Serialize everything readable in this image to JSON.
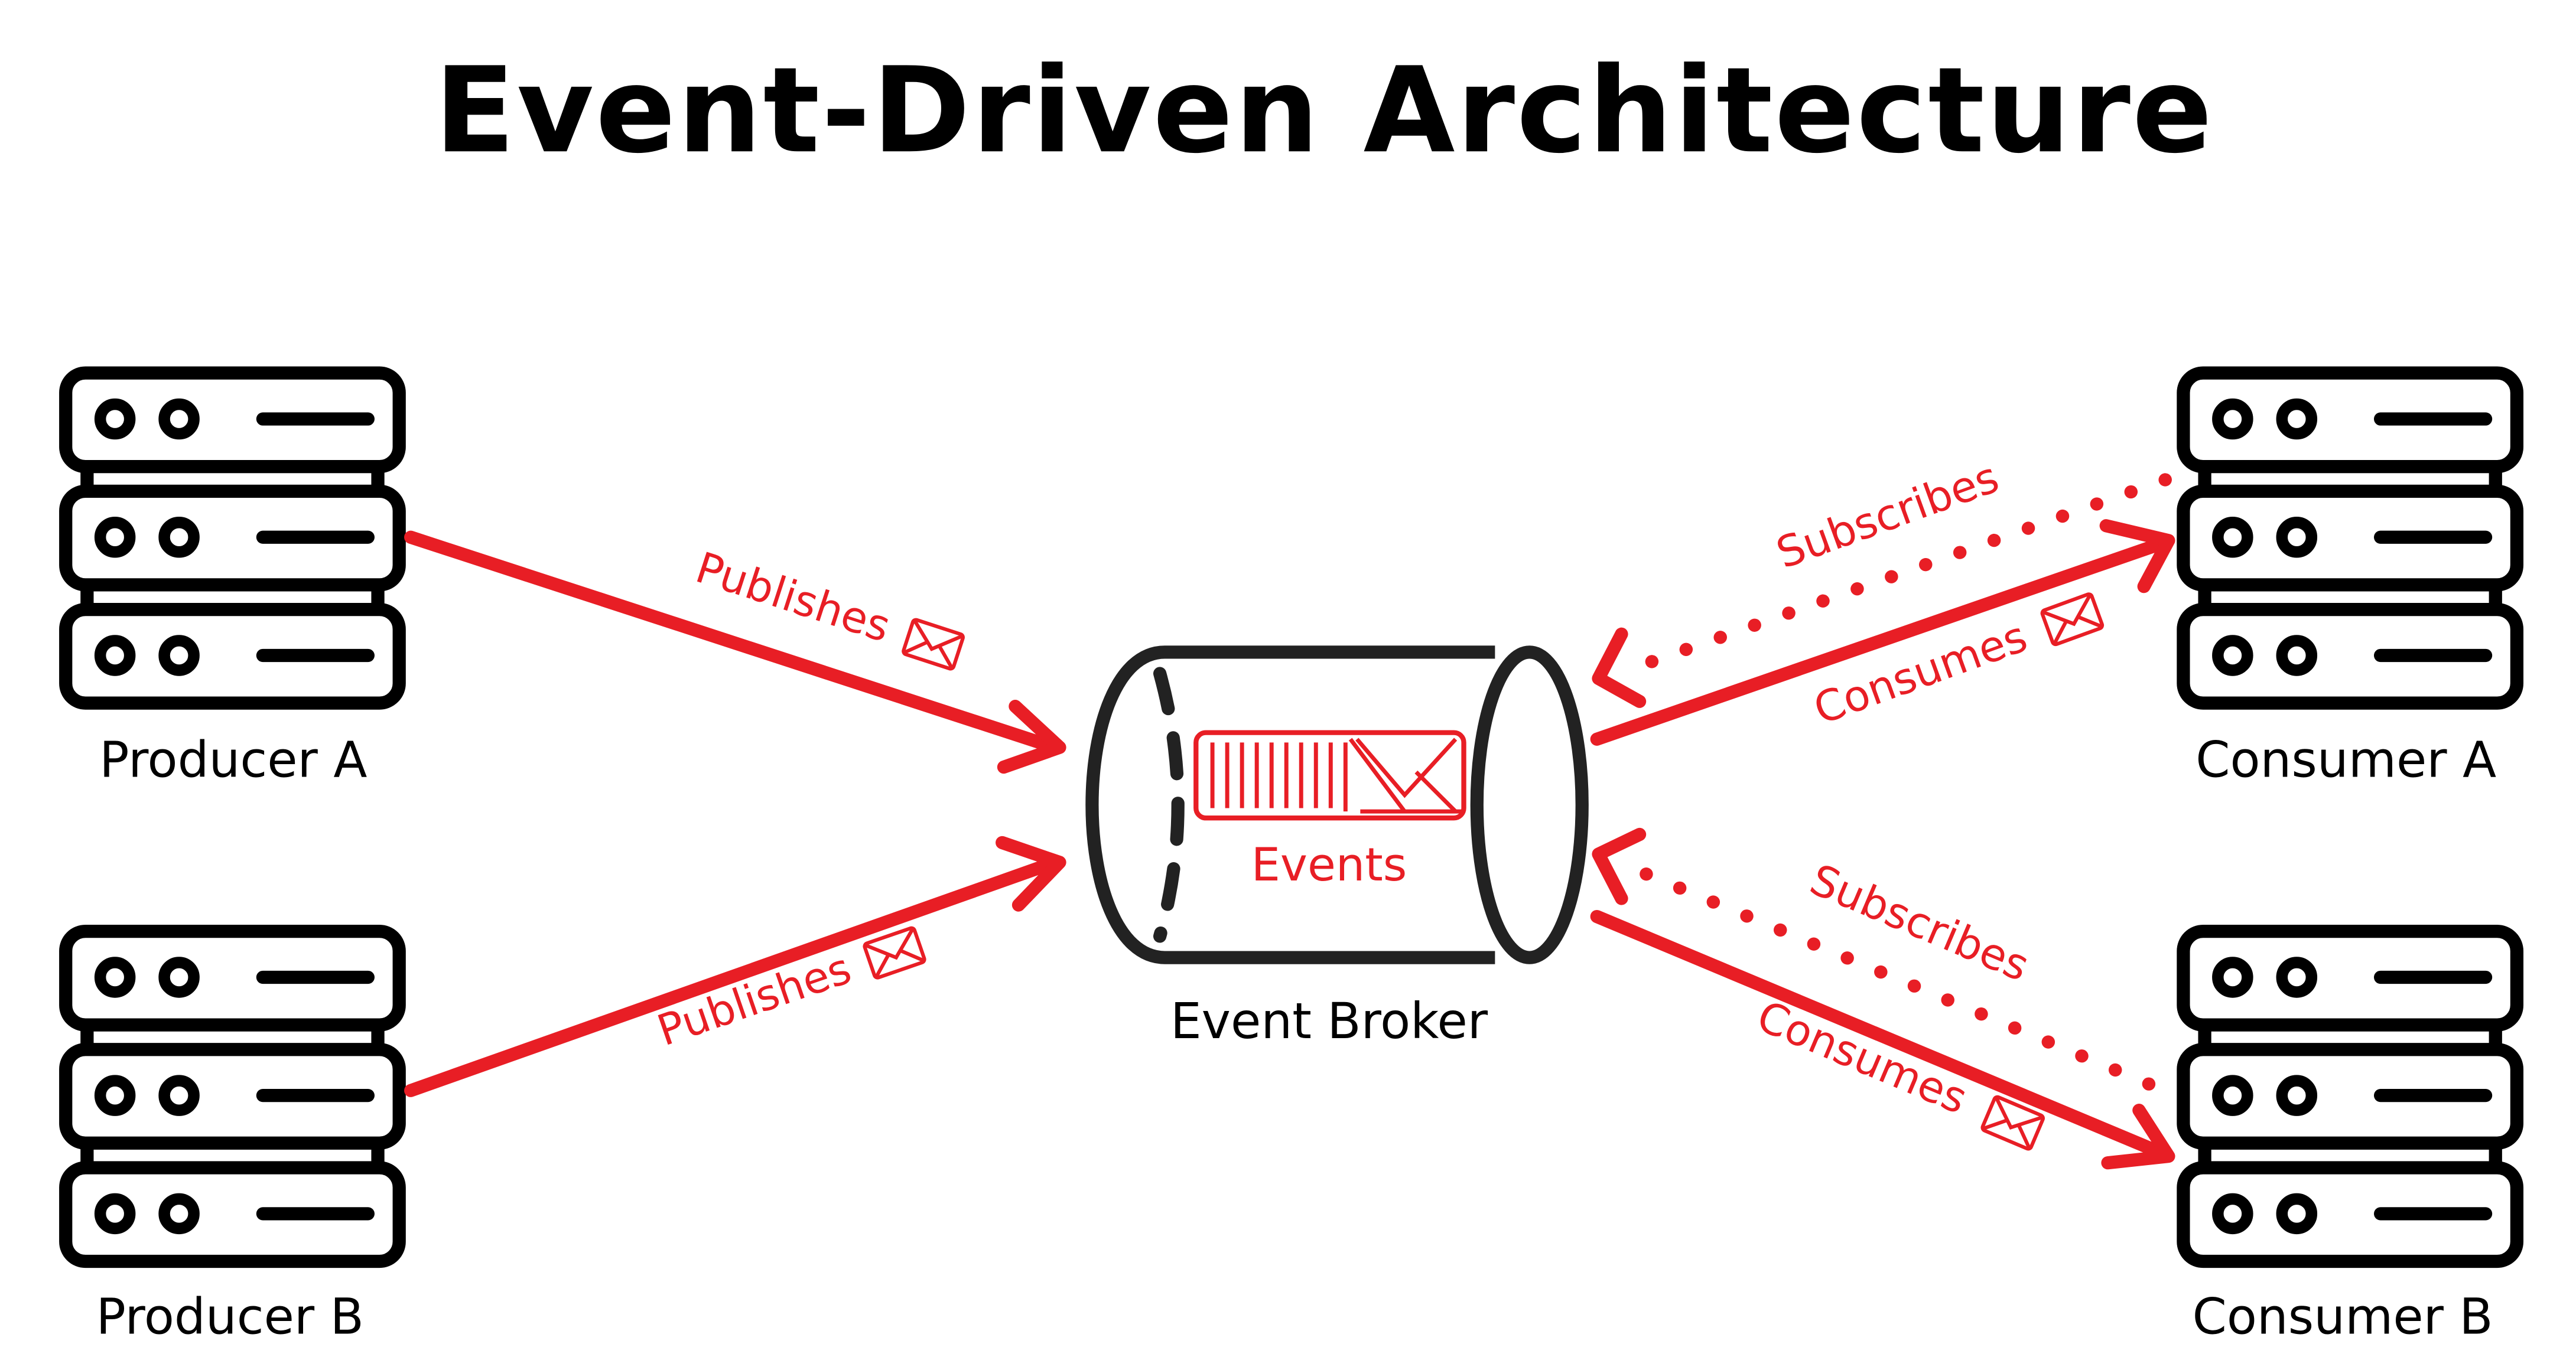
{
  "title": "Event-Driven Architecture",
  "colors": {
    "accent": "#E81E25",
    "stroke": "#000000",
    "broker_stroke": "#222222",
    "background": "#FFFFFF"
  },
  "nodes": {
    "producer_a": {
      "label": "Producer A",
      "icon": "server-rack-icon"
    },
    "producer_b": {
      "label": "Producer B",
      "icon": "server-rack-icon"
    },
    "consumer_a": {
      "label": "Consumer A",
      "icon": "server-rack-icon"
    },
    "consumer_b": {
      "label": "Consumer B",
      "icon": "server-rack-icon"
    },
    "broker": {
      "label": "Event Broker",
      "icon": "cylinder-queue-icon",
      "queue_label": "Events",
      "queue_icon": "envelope-stack-icon"
    }
  },
  "edges": [
    {
      "from": "Producer A",
      "to": "Event Broker",
      "label": "Publishes",
      "style": "solid",
      "icon": "envelope-icon"
    },
    {
      "from": "Producer B",
      "to": "Event Broker",
      "label": "Publishes",
      "style": "solid",
      "icon": "envelope-icon"
    },
    {
      "from": "Consumer A",
      "to": "Event Broker",
      "label": "Subscribes",
      "style": "dotted"
    },
    {
      "from": "Event Broker",
      "to": "Consumer A",
      "label": "Consumes",
      "style": "solid",
      "icon": "envelope-icon"
    },
    {
      "from": "Consumer B",
      "to": "Event Broker",
      "label": "Subscribes",
      "style": "dotted"
    },
    {
      "from": "Event Broker",
      "to": "Consumer B",
      "label": "Consumes",
      "style": "solid",
      "icon": "envelope-icon"
    }
  ]
}
